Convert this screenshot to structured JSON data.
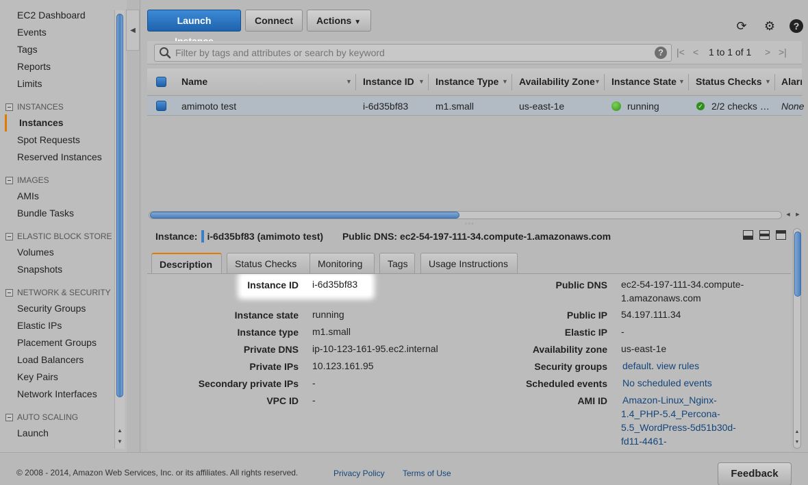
{
  "sidebar": {
    "top_items": [
      "EC2 Dashboard",
      "Events",
      "Tags",
      "Reports",
      "Limits"
    ],
    "sections": [
      {
        "title": "INSTANCES",
        "items": [
          "Instances",
          "Spot Requests",
          "Reserved Instances"
        ],
        "active": "Instances"
      },
      {
        "title": "IMAGES",
        "items": [
          "AMIs",
          "Bundle Tasks"
        ]
      },
      {
        "title": "ELASTIC BLOCK STORE",
        "items": [
          "Volumes",
          "Snapshots"
        ]
      },
      {
        "title": "NETWORK & SECURITY",
        "items": [
          "Security Groups",
          "Elastic IPs",
          "Placement Groups",
          "Load Balancers",
          "Key Pairs",
          "Network Interfaces"
        ]
      },
      {
        "title": "AUTO SCALING",
        "items": [
          "Launch"
        ]
      }
    ]
  },
  "toolbar": {
    "launch_label": "Launch Instance",
    "connect_label": "Connect",
    "actions_label": "Actions"
  },
  "filter": {
    "placeholder": "Filter by tags and attributes or search by keyword",
    "pager_text": "1 to 1 of 1"
  },
  "table": {
    "columns": [
      "Name",
      "Instance ID",
      "Instance Type",
      "Availability Zone",
      "Instance State",
      "Status Checks",
      "Alarm"
    ],
    "row": {
      "name": "amimoto test",
      "instance_id": "i-6d35bf83",
      "instance_type": "m1.small",
      "availability_zone": "us-east-1e",
      "instance_state": "running",
      "status_checks": "2/2 checks …",
      "alarm": "None"
    }
  },
  "detail": {
    "instance_label": "Instance:",
    "instance_value": "i-6d35bf83 (amimoto test)",
    "dns_label": "Public DNS:",
    "dns_value": "ec2-54-197-111-34.compute-1.amazonaws.com",
    "tabs": [
      "Description",
      "Status Checks",
      "Monitoring",
      "Tags",
      "Usage Instructions"
    ],
    "left": [
      {
        "label": "Instance ID",
        "value": "i-6d35bf83"
      },
      {
        "label": "Instance state",
        "value": "running"
      },
      {
        "label": "Instance type",
        "value": "m1.small"
      },
      {
        "label": "Private DNS",
        "value": "ip-10-123-161-95.ec2.internal"
      },
      {
        "label": "Private IPs",
        "value": "10.123.161.95"
      },
      {
        "label": "Secondary private IPs",
        "value": "-"
      },
      {
        "label": "VPC ID",
        "value": "-"
      }
    ],
    "right": {
      "public_dns_label": "Public DNS",
      "public_dns_line1": "ec2-54-197-111-34.compute-",
      "public_dns_line2": "1.amazonaws.com",
      "public_ip_label": "Public IP",
      "public_ip": "54.197.111.34",
      "elastic_ip_label": "Elastic IP",
      "elastic_ip": "-",
      "az_label": "Availability zone",
      "az": "us-east-1e",
      "sg_label": "Security groups",
      "sg_link": "default",
      "sg_sep": ".",
      "sg_rules": "view rules",
      "events_label": "Scheduled events",
      "events": "No scheduled events",
      "ami_label": "AMI ID",
      "ami_lines": [
        "Amazon-Linux_Nginx-",
        "1.4_PHP-5.4_Percona-",
        "5.5_WordPress-5d51b30d-",
        "fd11-4461-"
      ]
    }
  },
  "footer": {
    "copyright": "© 2008 - 2014, Amazon Web Services, Inc. or its affiliates. All rights reserved.",
    "privacy": "Privacy Policy",
    "terms": "Terms of Use",
    "feedback": "Feedback"
  }
}
